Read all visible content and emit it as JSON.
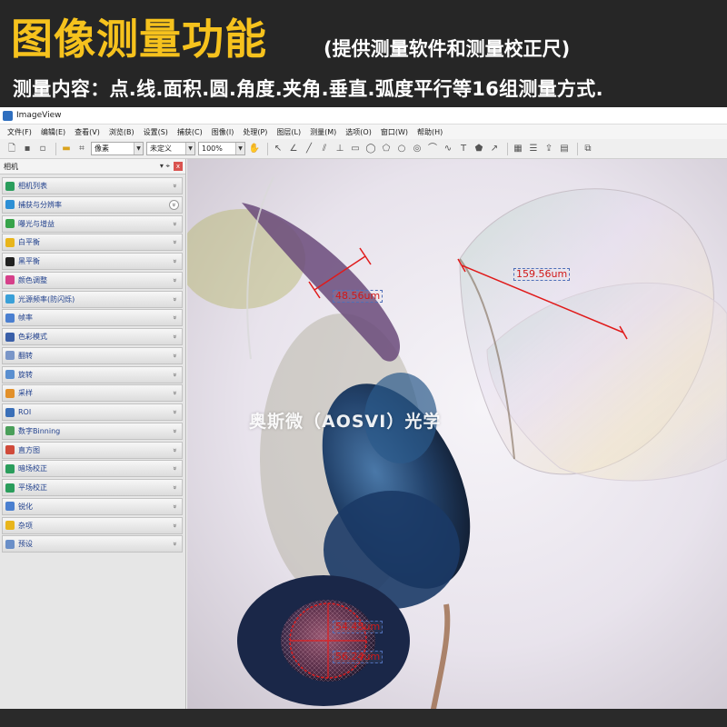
{
  "banner": {
    "title": "图像测量功能",
    "subtitle": "(提供测量软件和测量校正尺)",
    "description": "测量内容：点.线.面积.圆.角度.夹角.垂直.弧度平行等16组测量方式."
  },
  "window": {
    "title": "ImageView"
  },
  "menu": [
    "文件(F)",
    "编辑(E)",
    "查看(V)",
    "浏览(B)",
    "设置(S)",
    "捕获(C)",
    "图像(I)",
    "处理(P)",
    "图层(L)",
    "测量(M)",
    "选项(O)",
    "窗口(W)",
    "帮助(H)"
  ],
  "toolbar": {
    "unit_select": "像素",
    "calibration_select": "未定义",
    "zoom_select": "100%"
  },
  "sidebar": {
    "panel_title": "相机",
    "pin_label": "▾ ⌖",
    "close_label": "x",
    "items": [
      {
        "label": "相机列表",
        "icon": "camera-list-icon",
        "color": "#2a9d5c"
      },
      {
        "label": "捕获与分辨率",
        "icon": "capture-icon",
        "color": "#2d8fd5"
      },
      {
        "label": "曝光与增益",
        "icon": "exposure-icon",
        "color": "#37a34a"
      },
      {
        "label": "白平衡",
        "icon": "white-balance-icon",
        "color": "#e8b51c"
      },
      {
        "label": "黑平衡",
        "icon": "black-balance-icon",
        "color": "#222222"
      },
      {
        "label": "颜色调整",
        "icon": "color-adjust-icon",
        "color": "#d6408a"
      },
      {
        "label": "光源频率(防闪烁)",
        "icon": "light-frequency-icon",
        "color": "#3aa0d8"
      },
      {
        "label": "帧率",
        "icon": "frame-rate-icon",
        "color": "#4a7fd0"
      },
      {
        "label": "色彩模式",
        "icon": "color-mode-icon",
        "color": "#3a5fa8"
      },
      {
        "label": "翻转",
        "icon": "flip-icon",
        "color": "#7a96c8"
      },
      {
        "label": "旋转",
        "icon": "rotate-icon",
        "color": "#5a8fd0"
      },
      {
        "label": "采样",
        "icon": "sampling-icon",
        "color": "#e2902a"
      },
      {
        "label": "ROI",
        "icon": "roi-icon",
        "color": "#3a6fb8"
      },
      {
        "label": "数字Binning",
        "icon": "binning-icon",
        "color": "#4a9f5a"
      },
      {
        "label": "直方图",
        "icon": "histogram-icon",
        "color": "#d04a3a"
      },
      {
        "label": "暗场校正",
        "icon": "dark-field-icon",
        "color": "#2a9d5c"
      },
      {
        "label": "平场校正",
        "icon": "flat-field-icon",
        "color": "#2a9d5c"
      },
      {
        "label": "锐化",
        "icon": "sharpen-icon",
        "color": "#4a7fd0"
      },
      {
        "label": "杂项",
        "icon": "misc-icon",
        "color": "#e8b51c"
      },
      {
        "label": "预设",
        "icon": "preset-icon",
        "color": "#6a8fc8"
      }
    ]
  },
  "measurements": {
    "leg": "48.56um",
    "wing": "159.56um",
    "eye_1": "54.45um",
    "eye_2": "56.24um"
  },
  "watermark": "奥斯微（AOSVI）光学"
}
